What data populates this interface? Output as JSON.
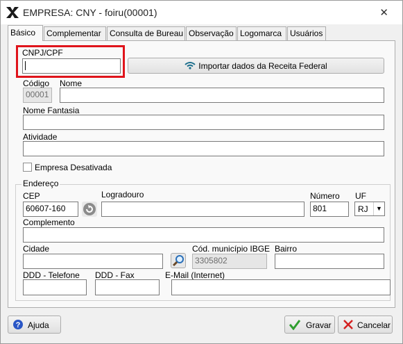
{
  "window": {
    "title": "EMPRESA: CNY - foiru(00001)",
    "close_symbol": "✕"
  },
  "tabs": [
    {
      "label": "Básico",
      "active": true
    },
    {
      "label": "Complementar"
    },
    {
      "label": "Consulta de Bureau"
    },
    {
      "label": "Observação"
    },
    {
      "label": "Logomarca"
    },
    {
      "label": "Usuários"
    }
  ],
  "form": {
    "cnpj_label": "CNPJ/CPF",
    "cnpj_value": "",
    "import_button": "Importar dados da Receita Federal",
    "codigo_label": "Código",
    "codigo_value": "00001",
    "nome_label": "Nome",
    "nome_value": "",
    "fantasia_label": "Nome Fantasia",
    "fantasia_value": "",
    "atividade_label": "Atividade",
    "atividade_value": "",
    "desativada_label": "Empresa Desativada",
    "desativada_checked": false
  },
  "endereco": {
    "group_label": "Endereço",
    "cep_label": "CEP",
    "cep_value": "60607-160",
    "logradouro_label": "Logradouro",
    "logradouro_value": "",
    "numero_label": "Número",
    "numero_value": "801",
    "uf_label": "UF",
    "uf_value": "RJ",
    "complemento_label": "Complemento",
    "complemento_value": "",
    "cidade_label": "Cidade",
    "cidade_value": "",
    "ibge_label": "Cód. município IBGE",
    "ibge_value": "3305802",
    "bairro_label": "Bairro",
    "bairro_value": "",
    "ddd_tel_label": "DDD - Telefone",
    "ddd_fax_label": "DDD - Fax",
    "email_label": "E-Mail (Internet)"
  },
  "footer": {
    "help_label": "Ajuda",
    "save_label": "Gravar",
    "cancel_label": "Cancelar"
  },
  "colors": {
    "highlight": "#e0141b",
    "save_icon": "#2e9e2e",
    "cancel_icon": "#d42020",
    "help_icon": "#2a56c6"
  }
}
